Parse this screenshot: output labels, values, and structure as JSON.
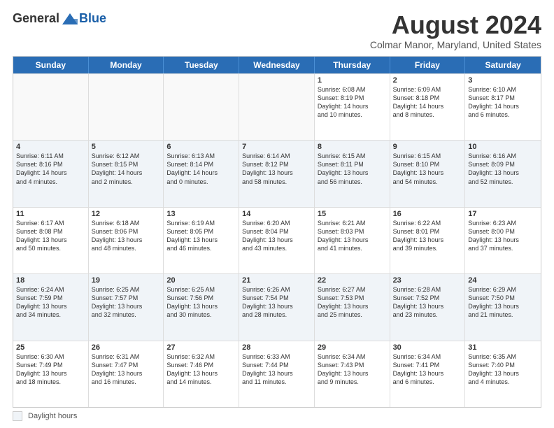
{
  "logo": {
    "general": "General",
    "blue": "Blue"
  },
  "title": "August 2024",
  "subtitle": "Colmar Manor, Maryland, United States",
  "days": [
    "Sunday",
    "Monday",
    "Tuesday",
    "Wednesday",
    "Thursday",
    "Friday",
    "Saturday"
  ],
  "legend_label": "Daylight hours",
  "rows": [
    [
      {
        "day": "",
        "info": ""
      },
      {
        "day": "",
        "info": ""
      },
      {
        "day": "",
        "info": ""
      },
      {
        "day": "",
        "info": ""
      },
      {
        "day": "1",
        "info": "Sunrise: 6:08 AM\nSunset: 8:19 PM\nDaylight: 14 hours\nand 10 minutes."
      },
      {
        "day": "2",
        "info": "Sunrise: 6:09 AM\nSunset: 8:18 PM\nDaylight: 14 hours\nand 8 minutes."
      },
      {
        "day": "3",
        "info": "Sunrise: 6:10 AM\nSunset: 8:17 PM\nDaylight: 14 hours\nand 6 minutes."
      }
    ],
    [
      {
        "day": "4",
        "info": "Sunrise: 6:11 AM\nSunset: 8:16 PM\nDaylight: 14 hours\nand 4 minutes."
      },
      {
        "day": "5",
        "info": "Sunrise: 6:12 AM\nSunset: 8:15 PM\nDaylight: 14 hours\nand 2 minutes."
      },
      {
        "day": "6",
        "info": "Sunrise: 6:13 AM\nSunset: 8:14 PM\nDaylight: 14 hours\nand 0 minutes."
      },
      {
        "day": "7",
        "info": "Sunrise: 6:14 AM\nSunset: 8:12 PM\nDaylight: 13 hours\nand 58 minutes."
      },
      {
        "day": "8",
        "info": "Sunrise: 6:15 AM\nSunset: 8:11 PM\nDaylight: 13 hours\nand 56 minutes."
      },
      {
        "day": "9",
        "info": "Sunrise: 6:15 AM\nSunset: 8:10 PM\nDaylight: 13 hours\nand 54 minutes."
      },
      {
        "day": "10",
        "info": "Sunrise: 6:16 AM\nSunset: 8:09 PM\nDaylight: 13 hours\nand 52 minutes."
      }
    ],
    [
      {
        "day": "11",
        "info": "Sunrise: 6:17 AM\nSunset: 8:08 PM\nDaylight: 13 hours\nand 50 minutes."
      },
      {
        "day": "12",
        "info": "Sunrise: 6:18 AM\nSunset: 8:06 PM\nDaylight: 13 hours\nand 48 minutes."
      },
      {
        "day": "13",
        "info": "Sunrise: 6:19 AM\nSunset: 8:05 PM\nDaylight: 13 hours\nand 46 minutes."
      },
      {
        "day": "14",
        "info": "Sunrise: 6:20 AM\nSunset: 8:04 PM\nDaylight: 13 hours\nand 43 minutes."
      },
      {
        "day": "15",
        "info": "Sunrise: 6:21 AM\nSunset: 8:03 PM\nDaylight: 13 hours\nand 41 minutes."
      },
      {
        "day": "16",
        "info": "Sunrise: 6:22 AM\nSunset: 8:01 PM\nDaylight: 13 hours\nand 39 minutes."
      },
      {
        "day": "17",
        "info": "Sunrise: 6:23 AM\nSunset: 8:00 PM\nDaylight: 13 hours\nand 37 minutes."
      }
    ],
    [
      {
        "day": "18",
        "info": "Sunrise: 6:24 AM\nSunset: 7:59 PM\nDaylight: 13 hours\nand 34 minutes."
      },
      {
        "day": "19",
        "info": "Sunrise: 6:25 AM\nSunset: 7:57 PM\nDaylight: 13 hours\nand 32 minutes."
      },
      {
        "day": "20",
        "info": "Sunrise: 6:25 AM\nSunset: 7:56 PM\nDaylight: 13 hours\nand 30 minutes."
      },
      {
        "day": "21",
        "info": "Sunrise: 6:26 AM\nSunset: 7:54 PM\nDaylight: 13 hours\nand 28 minutes."
      },
      {
        "day": "22",
        "info": "Sunrise: 6:27 AM\nSunset: 7:53 PM\nDaylight: 13 hours\nand 25 minutes."
      },
      {
        "day": "23",
        "info": "Sunrise: 6:28 AM\nSunset: 7:52 PM\nDaylight: 13 hours\nand 23 minutes."
      },
      {
        "day": "24",
        "info": "Sunrise: 6:29 AM\nSunset: 7:50 PM\nDaylight: 13 hours\nand 21 minutes."
      }
    ],
    [
      {
        "day": "25",
        "info": "Sunrise: 6:30 AM\nSunset: 7:49 PM\nDaylight: 13 hours\nand 18 minutes."
      },
      {
        "day": "26",
        "info": "Sunrise: 6:31 AM\nSunset: 7:47 PM\nDaylight: 13 hours\nand 16 minutes."
      },
      {
        "day": "27",
        "info": "Sunrise: 6:32 AM\nSunset: 7:46 PM\nDaylight: 13 hours\nand 14 minutes."
      },
      {
        "day": "28",
        "info": "Sunrise: 6:33 AM\nSunset: 7:44 PM\nDaylight: 13 hours\nand 11 minutes."
      },
      {
        "day": "29",
        "info": "Sunrise: 6:34 AM\nSunset: 7:43 PM\nDaylight: 13 hours\nand 9 minutes."
      },
      {
        "day": "30",
        "info": "Sunrise: 6:34 AM\nSunset: 7:41 PM\nDaylight: 13 hours\nand 6 minutes."
      },
      {
        "day": "31",
        "info": "Sunrise: 6:35 AM\nSunset: 7:40 PM\nDaylight: 13 hours\nand 4 minutes."
      }
    ]
  ]
}
